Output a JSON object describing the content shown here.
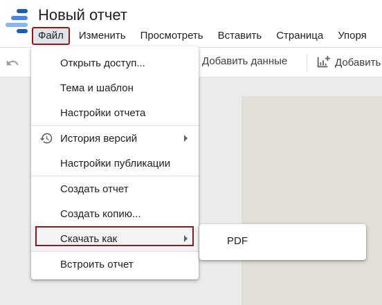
{
  "app": {
    "title": "Новый отчет"
  },
  "menubar": {
    "items": [
      "Файл",
      "Изменить",
      "Просмотреть",
      "Вставить",
      "Страница",
      "Упоря"
    ]
  },
  "toolbar": {
    "add_data_label": "Добавить данные",
    "add_chart_label": "Добавить"
  },
  "file_menu": {
    "items": [
      "Открыть доступ...",
      "Тема и шаблон",
      "Настройки отчета",
      "История версий",
      "Настройки публикации",
      "Создать отчет",
      "Создать копию...",
      "Скачать как",
      "Встроить отчет"
    ]
  },
  "download_submenu": {
    "items": [
      "PDF"
    ]
  },
  "colors": {
    "highlight_border": "#8b1a1a",
    "logo_blue_dark": "#1a5fb4",
    "logo_blue": "#4285f4",
    "logo_blue_light": "#8ab4f8"
  }
}
